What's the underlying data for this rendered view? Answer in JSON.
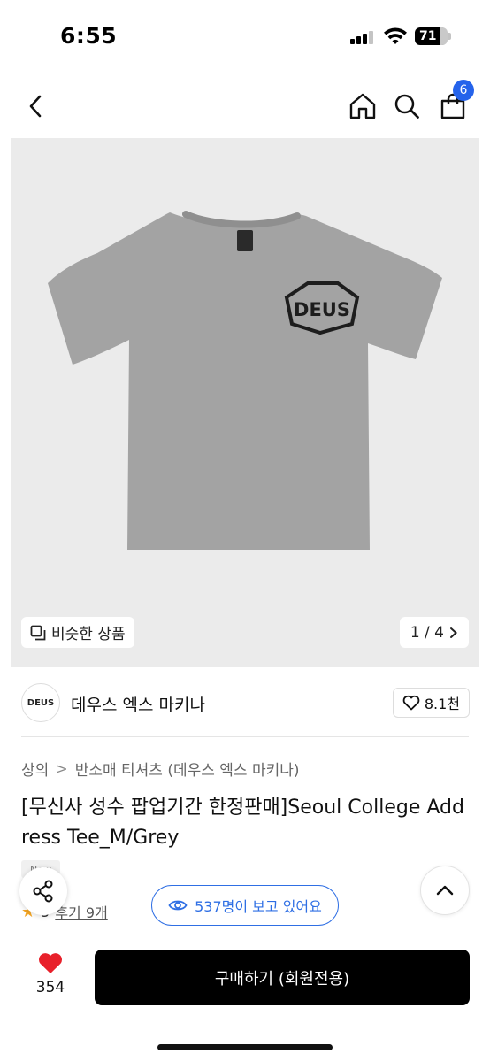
{
  "status_bar": {
    "time": "6:55",
    "battery": "71"
  },
  "nav": {
    "cart_count": "6"
  },
  "image": {
    "logo_text": "DEUS",
    "similar_label": "비슷한 상품",
    "pager": "1 / 4"
  },
  "brand": {
    "logo_text": "DEUS",
    "name": "데우스 엑스 마키나",
    "likes": "8.1천"
  },
  "breadcrumb": [
    "상의",
    "반소매 티셔츠 (데우스 엑스 마키나)"
  ],
  "product": {
    "title": "[무신사 성수 팝업기간 한정판매]Seoul College Address Tee_M/Grey",
    "tag": "New",
    "rating_prefix": "5",
    "review_label": "후기 9개",
    "viewers": "537명이 보고 있어요"
  },
  "bottom": {
    "wish_count": "354",
    "buy_label": "구매하기 (회원전용)"
  },
  "colors": {
    "accent_blue": "#2f6fe4",
    "badge_blue": "#2563eb",
    "heart_red": "#e8202a",
    "star": "#f5a623",
    "tee_grey": "#a3a3a3",
    "image_bg": "#ebebeb"
  },
  "icons": [
    "back-icon",
    "home-icon",
    "search-icon",
    "bag-icon",
    "copy-icon",
    "chevron-right-icon",
    "heart-outline-icon",
    "share-icon",
    "eye-icon",
    "chevron-up-icon",
    "heart-filled-icon",
    "star-icon"
  ]
}
